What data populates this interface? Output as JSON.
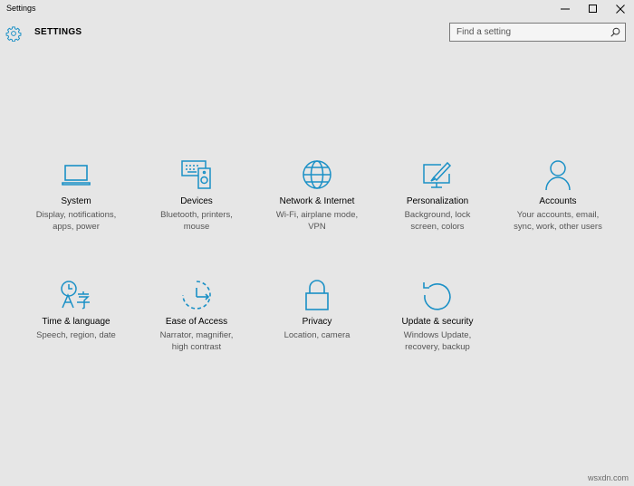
{
  "window": {
    "title": "Settings",
    "controls": {
      "minimize_icon": "minimize-icon",
      "maximize_icon": "maximize-icon",
      "close_icon": "close-icon"
    }
  },
  "header": {
    "icon": "gear-icon",
    "heading": "SETTINGS"
  },
  "search": {
    "placeholder": "Find a setting",
    "value": "",
    "icon": "search-icon"
  },
  "accent_color": "#1a90c6",
  "tiles": [
    {
      "icon": "laptop-icon",
      "title": "System",
      "desc": [
        "Display, notifications,",
        "apps, power"
      ]
    },
    {
      "icon": "devices-icon",
      "title": "Devices",
      "desc": [
        "Bluetooth, printers,",
        "mouse"
      ]
    },
    {
      "icon": "globe-icon",
      "title": "Network & Internet",
      "desc": [
        "Wi-Fi, airplane mode,",
        "VPN"
      ]
    },
    {
      "icon": "personalization-icon",
      "title": "Personalization",
      "desc": [
        "Background, lock",
        "screen, colors"
      ]
    },
    {
      "icon": "person-icon",
      "title": "Accounts",
      "desc": [
        "Your accounts, email,",
        "sync, work, other users"
      ]
    },
    {
      "icon": "time-language-icon",
      "title": "Time & language",
      "desc": [
        "Speech, region, date"
      ]
    },
    {
      "icon": "ease-of-access-icon",
      "title": "Ease of Access",
      "desc": [
        "Narrator, magnifier,",
        "high contrast"
      ]
    },
    {
      "icon": "lock-icon",
      "title": "Privacy",
      "desc": [
        "Location, camera"
      ]
    },
    {
      "icon": "update-icon",
      "title": "Update & security",
      "desc": [
        "Windows Update,",
        "recovery, backup"
      ]
    }
  ],
  "watermark": "wsxdn.com"
}
